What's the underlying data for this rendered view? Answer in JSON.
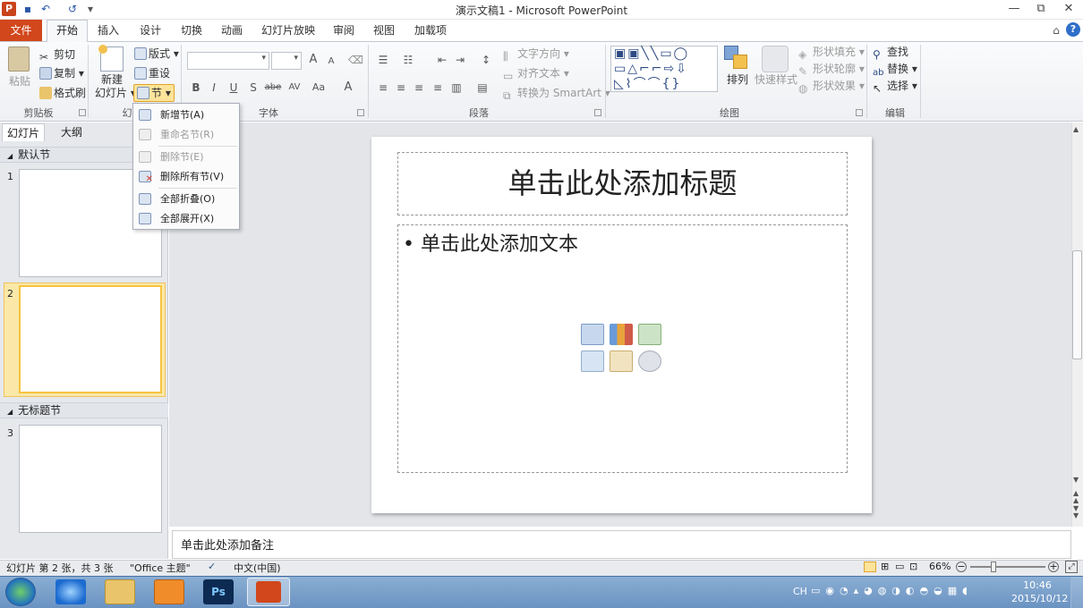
{
  "window": {
    "title": "演示文稿1 - Microsoft PowerPoint",
    "logo": "P",
    "minimize": "▭",
    "restore": "⧉",
    "close": "✕"
  },
  "qat": {
    "save_icon": "save-icon",
    "undo": "↶",
    "redo": "↺",
    "customize": "▾"
  },
  "tabs": {
    "file": "文件",
    "items": [
      "开始",
      "插入",
      "设计",
      "切换",
      "动画",
      "幻灯片放映",
      "审阅",
      "视图",
      "加载项"
    ],
    "help": "?",
    "collapse": "⌂"
  },
  "ribbon": {
    "clipboard": {
      "label": "剪贴板",
      "paste": "粘贴",
      "cut": "剪切",
      "copy": "复制",
      "format_painter": "格式刷"
    },
    "slides": {
      "label": "幻",
      "new_slide_1": "新建",
      "new_slide_2": "幻灯片",
      "layout": "版式",
      "reset": "重设",
      "section": "节"
    },
    "font": {
      "label": "字体",
      "bold": "B",
      "italic": "I",
      "underline": "U",
      "shadow": "S",
      "strike": "abe",
      "spacing": "AV",
      "case": "Aa",
      "color": "A",
      "grow": "A",
      "shrink": "A"
    },
    "paragraph": {
      "label": "段落",
      "text_direction": "文字方向",
      "align_text": "对齐文本",
      "smartart": "转换为 SmartArt"
    },
    "drawing": {
      "label": "绘图",
      "arrange": "排列",
      "quick_styles": "快速样式",
      "shape_fill": "形状填充",
      "shape_outline": "形状轮廓",
      "shape_effects": "形状效果"
    },
    "editing": {
      "label": "编辑",
      "find": "查找",
      "replace": "替换",
      "select": "选择"
    }
  },
  "section_menu": {
    "add": "新增节(A)",
    "rename": "重命名节(R)",
    "remove": "删除节(E)",
    "remove_all": "删除所有节(V)",
    "collapse_all": "全部折叠(O)",
    "expand_all": "全部展开(X)"
  },
  "left_pane": {
    "tab_slides": "幻灯片",
    "tab_outline": "大纲",
    "sections": [
      {
        "name": "默认节",
        "slides": [
          "1",
          "2"
        ]
      },
      {
        "name": "无标题节",
        "slides": [
          "3"
        ]
      }
    ]
  },
  "slide": {
    "title_placeholder": "单击此处添加标题",
    "body_placeholder": "单击此处添加文本",
    "bullet": "•"
  },
  "notes": {
    "placeholder": "单击此处添加备注"
  },
  "status": {
    "slide_count": "幻灯片 第 2 张，共 3 张",
    "theme": "\"Office 主题\"",
    "language": "中文(中国)",
    "zoom": "66%"
  },
  "taskbar": {
    "ime": "CH",
    "time": "10:46",
    "date": "2015/10/12"
  },
  "colors": {
    "accent": "#d2471c",
    "selected_thumb": "#f6c342"
  }
}
